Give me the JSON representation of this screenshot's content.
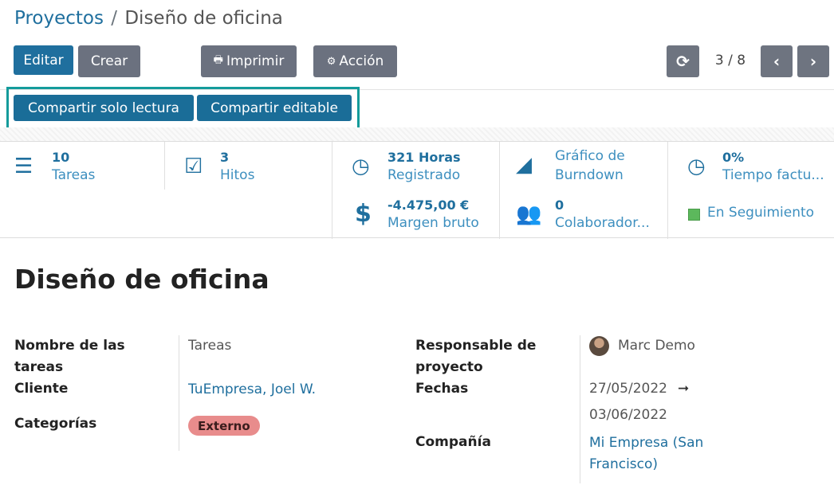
{
  "breadcrumb": {
    "parent": "Proyectos",
    "separator": "/",
    "current": "Diseño de oficina"
  },
  "toolbar": {
    "edit_label": "Editar",
    "create_label": "Crear",
    "print_label": "Imprimir",
    "action_label": "Acción",
    "pager_text": "3 / 8"
  },
  "share": {
    "readonly_label": "Compartir solo lectura",
    "editable_label": "Compartir editable"
  },
  "stats": {
    "tasks": {
      "value": "10",
      "label": "Tareas"
    },
    "milestones": {
      "value": "3",
      "label": "Hitos"
    },
    "hours": {
      "value": "321 Horas",
      "label": "Registrado"
    },
    "margin": {
      "value": "-4.475,00 €",
      "label": "Margen bruto"
    },
    "burndown": {
      "line1": "Gráfico de",
      "line2": "Burndown"
    },
    "collaborators": {
      "value": "0",
      "label": "Colaborador..."
    },
    "billable": {
      "value": "0%",
      "label": "Tiempo factu..."
    },
    "status": {
      "label": "En Seguimiento",
      "color": "#5cb85c"
    }
  },
  "record": {
    "title": "Diseño de oficina",
    "left": {
      "task_name_label_1": "Nombre de las",
      "task_name_label_2": "tareas",
      "task_name_value": "Tareas",
      "customer_label": "Cliente",
      "customer_value": "TuEmpresa, Joel W.",
      "tags_label": "Categorías",
      "tags_value": "Externo"
    },
    "right": {
      "manager_label_1": "Responsable de",
      "manager_label_2": "proyecto",
      "manager_value": "Marc Demo",
      "dates_label": "Fechas",
      "date_start": "27/05/2022",
      "date_arrow": "➞",
      "date_end": "03/06/2022",
      "company_label": "Compañía",
      "company_value_1": "Mi Empresa (San",
      "company_value_2": "Francisco)"
    }
  },
  "colors": {
    "primary": "#1f6f9e",
    "share_highlight": "#149b9b",
    "tag": "#e88c8c"
  }
}
